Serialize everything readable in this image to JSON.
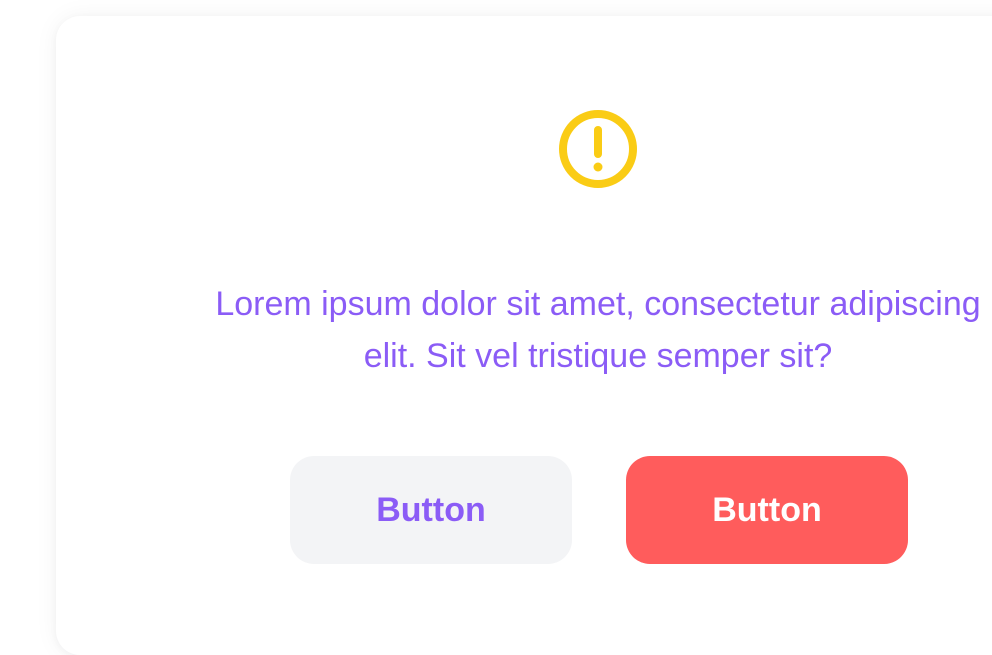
{
  "dialog": {
    "message": "Lorem ipsum dolor sit amet, consectetur adipiscing elit. Sit vel tristique semper sit?",
    "icon": "alert-circle-icon",
    "secondary_button_label": "Button",
    "primary_button_label": "Button"
  },
  "colors": {
    "accent": "#8b5cf6",
    "warning": "#facc15",
    "danger": "#ff5c5c",
    "secondary_bg": "#f3f4f6"
  }
}
